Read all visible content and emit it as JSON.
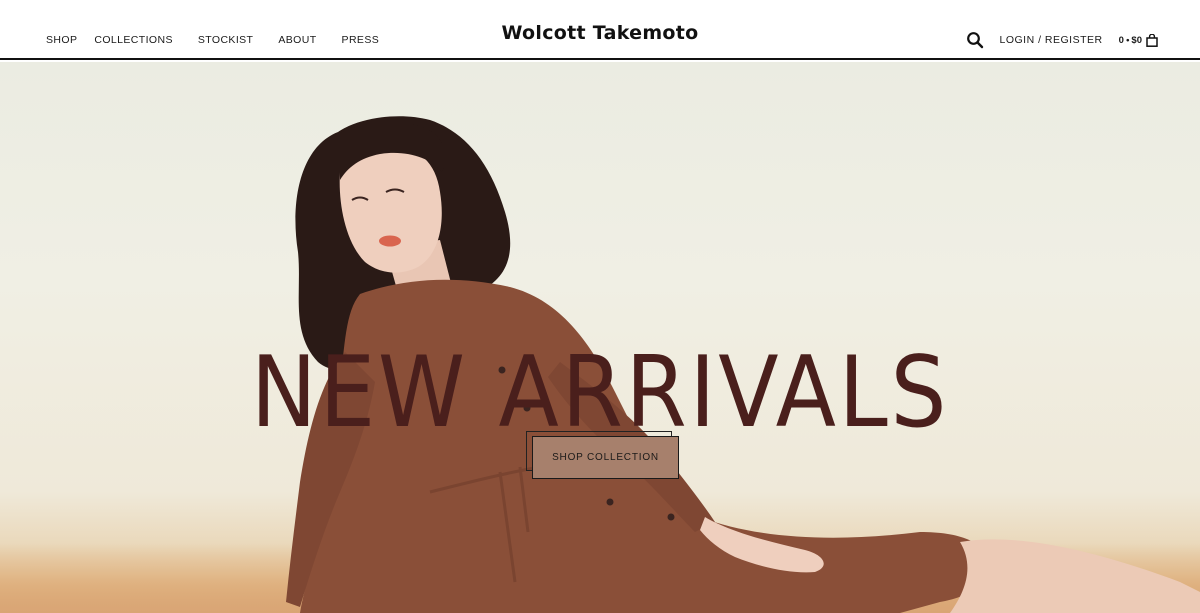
{
  "brand": {
    "name": "Wolcott Takemoto"
  },
  "nav": {
    "items": [
      "SHOP",
      "COLLECTIONS",
      "STOCKIST",
      "ABOUT",
      "PRESS"
    ]
  },
  "account": {
    "login_label": "LOGIN / REGISTER"
  },
  "cart": {
    "count": "0",
    "separator": "•",
    "total": "$0"
  },
  "icons": {
    "search": "search-icon",
    "cart": "shopping-bag-icon"
  },
  "hero": {
    "title": "NEW ARRIVALS",
    "cta_label": "SHOP COLLECTION",
    "image": "woman-in-brown-shirt-dress-photo"
  },
  "colors": {
    "title": "#4a1f1c",
    "cta_background": "#a7806c",
    "dress": "#8a4f38",
    "backdrop": "#eeeee3"
  }
}
